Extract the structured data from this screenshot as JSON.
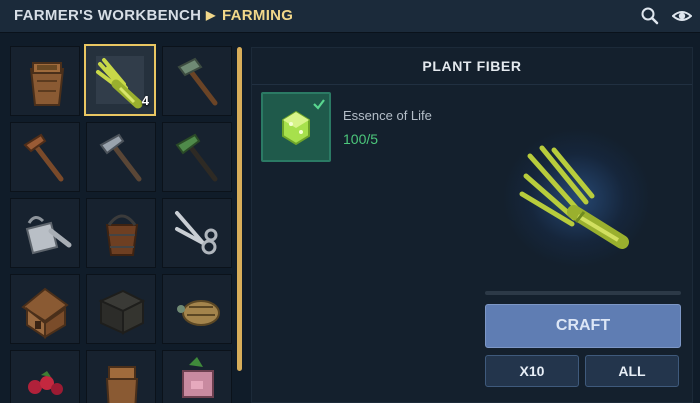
{
  "header": {
    "workbench": "FARMER'S WORKBENCH",
    "separator": "▶",
    "category": "FARMING"
  },
  "icons": {
    "search": "search-icon",
    "visibility": "eye-icon"
  },
  "recipes": [
    {
      "item": "seed-basket",
      "selected": false
    },
    {
      "item": "plant-fiber",
      "selected": true,
      "count": "4"
    },
    {
      "item": "stone-hoe",
      "selected": false
    },
    {
      "item": "wooden-hoe",
      "selected": false
    },
    {
      "item": "iron-hoe",
      "selected": false
    },
    {
      "item": "verdant-hoe",
      "selected": false
    },
    {
      "item": "watering-can",
      "selected": false
    },
    {
      "item": "wooden-bucket",
      "selected": false
    },
    {
      "item": "shears",
      "selected": false
    },
    {
      "item": "coop",
      "selected": false
    },
    {
      "item": "storage-crate",
      "selected": false
    },
    {
      "item": "bee-hive",
      "selected": false
    },
    {
      "item": "berries",
      "selected": false
    },
    {
      "item": "planter-box",
      "selected": false
    },
    {
      "item": "pig-statue",
      "selected": false
    }
  ],
  "detail": {
    "title": "PLANT FIBER",
    "ingredient": {
      "name": "Essence of Life",
      "count": "100/5",
      "status": "check-icon"
    }
  },
  "buttons": {
    "craft": "CRAFT",
    "x10": "X10",
    "all": "ALL"
  },
  "colors": {
    "accent_gold": "#e9c662",
    "ingredient_ok": "#4cc77b",
    "craft_button": "#5f7db3"
  }
}
